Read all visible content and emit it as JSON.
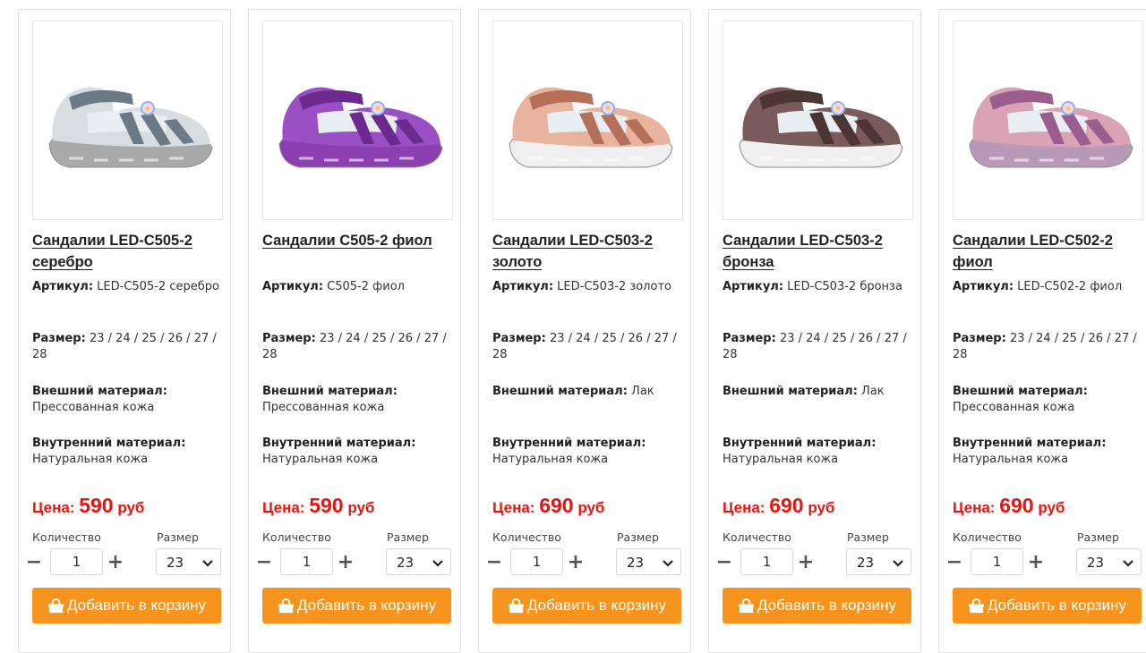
{
  "products": [
    {
      "title": "Сандалии LED-C505-2 серебро",
      "sku_label": "Артикул:",
      "sku": "LED-C505-2 серебро",
      "size_label": "Размер:",
      "sizes": "23 / 24 / 25 / 26 / 27 / 28",
      "outer_label": "Внешний материал:",
      "outer": "Прессованная кожа",
      "inner_label": "Внутренний материал:",
      "inner": "Натуральная кожа",
      "price_label": "Цена:",
      "price": "590",
      "currency": "руб",
      "qty_label": "Количество",
      "qty": "1",
      "size_select_label": "Размер",
      "size_selected": "23",
      "add_label": "Добавить в корзину",
      "image_icon": "sandal-silver",
      "colors": {
        "main": "#d8dde2",
        "accent": "#6c7a86",
        "sole": "#a9a9a9"
      }
    },
    {
      "title": "Сандалии C505-2 фиол",
      "sku_label": "Артикул:",
      "sku": "C505-2 фиол",
      "size_label": "Размер:",
      "sizes": "23 / 24 / 25 / 26 / 27 / 28",
      "outer_label": "Внешний материал:",
      "outer": "Прессованная кожа",
      "inner_label": "Внутренний материал:",
      "inner": "Натуральная кожа",
      "price_label": "Цена:",
      "price": "590",
      "currency": "руб",
      "qty_label": "Количество",
      "qty": "1",
      "size_select_label": "Размер",
      "size_selected": "23",
      "add_label": "Добавить в корзину",
      "image_icon": "sandal-purple",
      "colors": {
        "main": "#9b4fc4",
        "accent": "#6c2a8f",
        "sole": "#8b3fb0"
      }
    },
    {
      "title": "Сандалии LED-C503-2 золото",
      "sku_label": "Артикул:",
      "sku": "LED-C503-2 золото",
      "size_label": "Размер:",
      "sizes": "23 / 24 / 25 / 26 / 27 / 28",
      "outer_label": "Внешний материал:",
      "outer": "Лак",
      "inner_label": "Внутренний материал:",
      "inner": "Натуральная кожа",
      "price_label": "Цена:",
      "price": "690",
      "currency": "руб",
      "qty_label": "Количество",
      "qty": "1",
      "size_select_label": "Размер",
      "size_selected": "23",
      "add_label": "Добавить в корзину",
      "image_icon": "sandal-gold",
      "colors": {
        "main": "#e9b49d",
        "accent": "#b5705a",
        "sole": "#f0f0f0"
      }
    },
    {
      "title": "Сандалии LED-C503-2 бронза",
      "sku_label": "Артикул:",
      "sku": "LED-C503-2 бронза",
      "size_label": "Размер:",
      "sizes": "23 / 24 / 25 / 26 / 27 / 28",
      "outer_label": "Внешний материал:",
      "outer": "Лак",
      "inner_label": "Внутренний материал:",
      "inner": "Натуральная кожа",
      "price_label": "Цена:",
      "price": "690",
      "currency": "руб",
      "qty_label": "Количество",
      "qty": "1",
      "size_select_label": "Размер",
      "size_selected": "23",
      "add_label": "Добавить в корзину",
      "image_icon": "sandal-bronze",
      "colors": {
        "main": "#7a5a5a",
        "accent": "#4d3535",
        "sole": "#f0f0f0"
      }
    },
    {
      "title": "Сандалии LED-C502-2 фиол",
      "sku_label": "Артикул:",
      "sku": "LED-C502-2 фиол",
      "size_label": "Размер:",
      "sizes": "23 / 24 / 25 / 26 / 27 / 28",
      "outer_label": "Внешний материал:",
      "outer": "Прессованная кожа",
      "inner_label": "Внутренний материал:",
      "inner": "Натуральная кожа",
      "price_label": "Цена:",
      "price": "690",
      "currency": "руб",
      "qty_label": "Количество",
      "qty": "1",
      "size_select_label": "Размер",
      "size_selected": "23",
      "add_label": "Добавить в корзину",
      "image_icon": "sandal-pink",
      "colors": {
        "main": "#d9a3b5",
        "accent": "#9a5d8e",
        "sole": "#b89ab8"
      }
    }
  ],
  "theme": {
    "price_color": "#e8150f",
    "button_color": "#f7941d"
  }
}
